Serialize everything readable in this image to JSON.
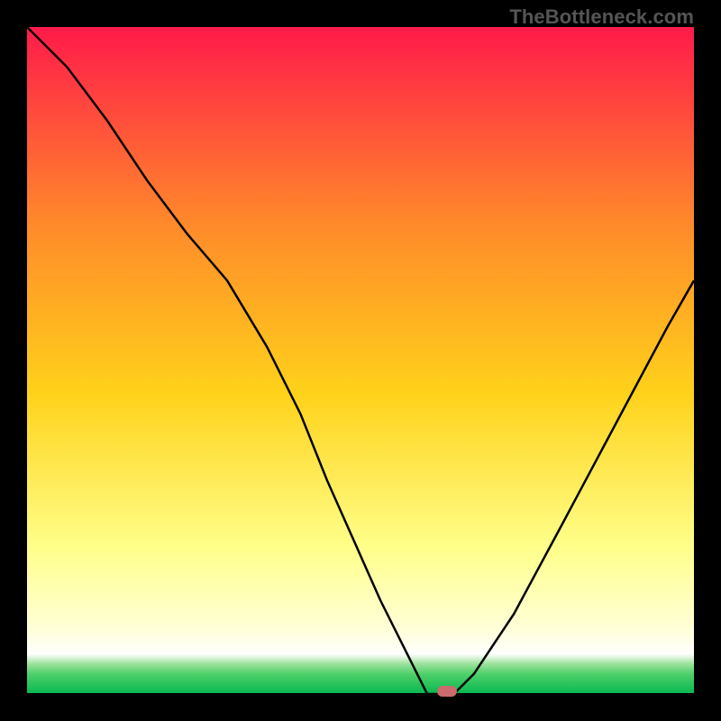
{
  "credit": "TheBottleneck.com",
  "colors": {
    "top": "#ff1a4a",
    "upper_mid": "#ff8b2a",
    "mid": "#ffd21a",
    "lower_mid": "#ffff8a",
    "pale": "#ffffd6",
    "white_band": "#ffffff",
    "green_top": "#9be29c",
    "green_mid": "#4fd06a",
    "green_base": "#05b84f",
    "curve": "#000000",
    "baseline": "#000000",
    "marker": "#cb6b6e"
  },
  "chart_data": {
    "type": "line",
    "title": "",
    "xlabel": "",
    "ylabel": "",
    "ylim": [
      0,
      100
    ],
    "xlim": [
      0,
      100
    ],
    "x": [
      0,
      6,
      12,
      18,
      24,
      30,
      36,
      41,
      45,
      49,
      53,
      57,
      59,
      60,
      62,
      64,
      67,
      73,
      80,
      88,
      96,
      100
    ],
    "values": [
      100,
      94,
      86,
      77,
      69,
      62,
      52,
      42,
      32,
      23,
      14,
      6,
      2,
      0,
      0,
      0,
      3,
      12,
      25,
      40,
      55,
      62
    ],
    "inflection_note": "slight slope change near x≈24",
    "min_plateau_x": [
      59,
      64
    ],
    "marker_x": 63,
    "marker_y": 0
  }
}
